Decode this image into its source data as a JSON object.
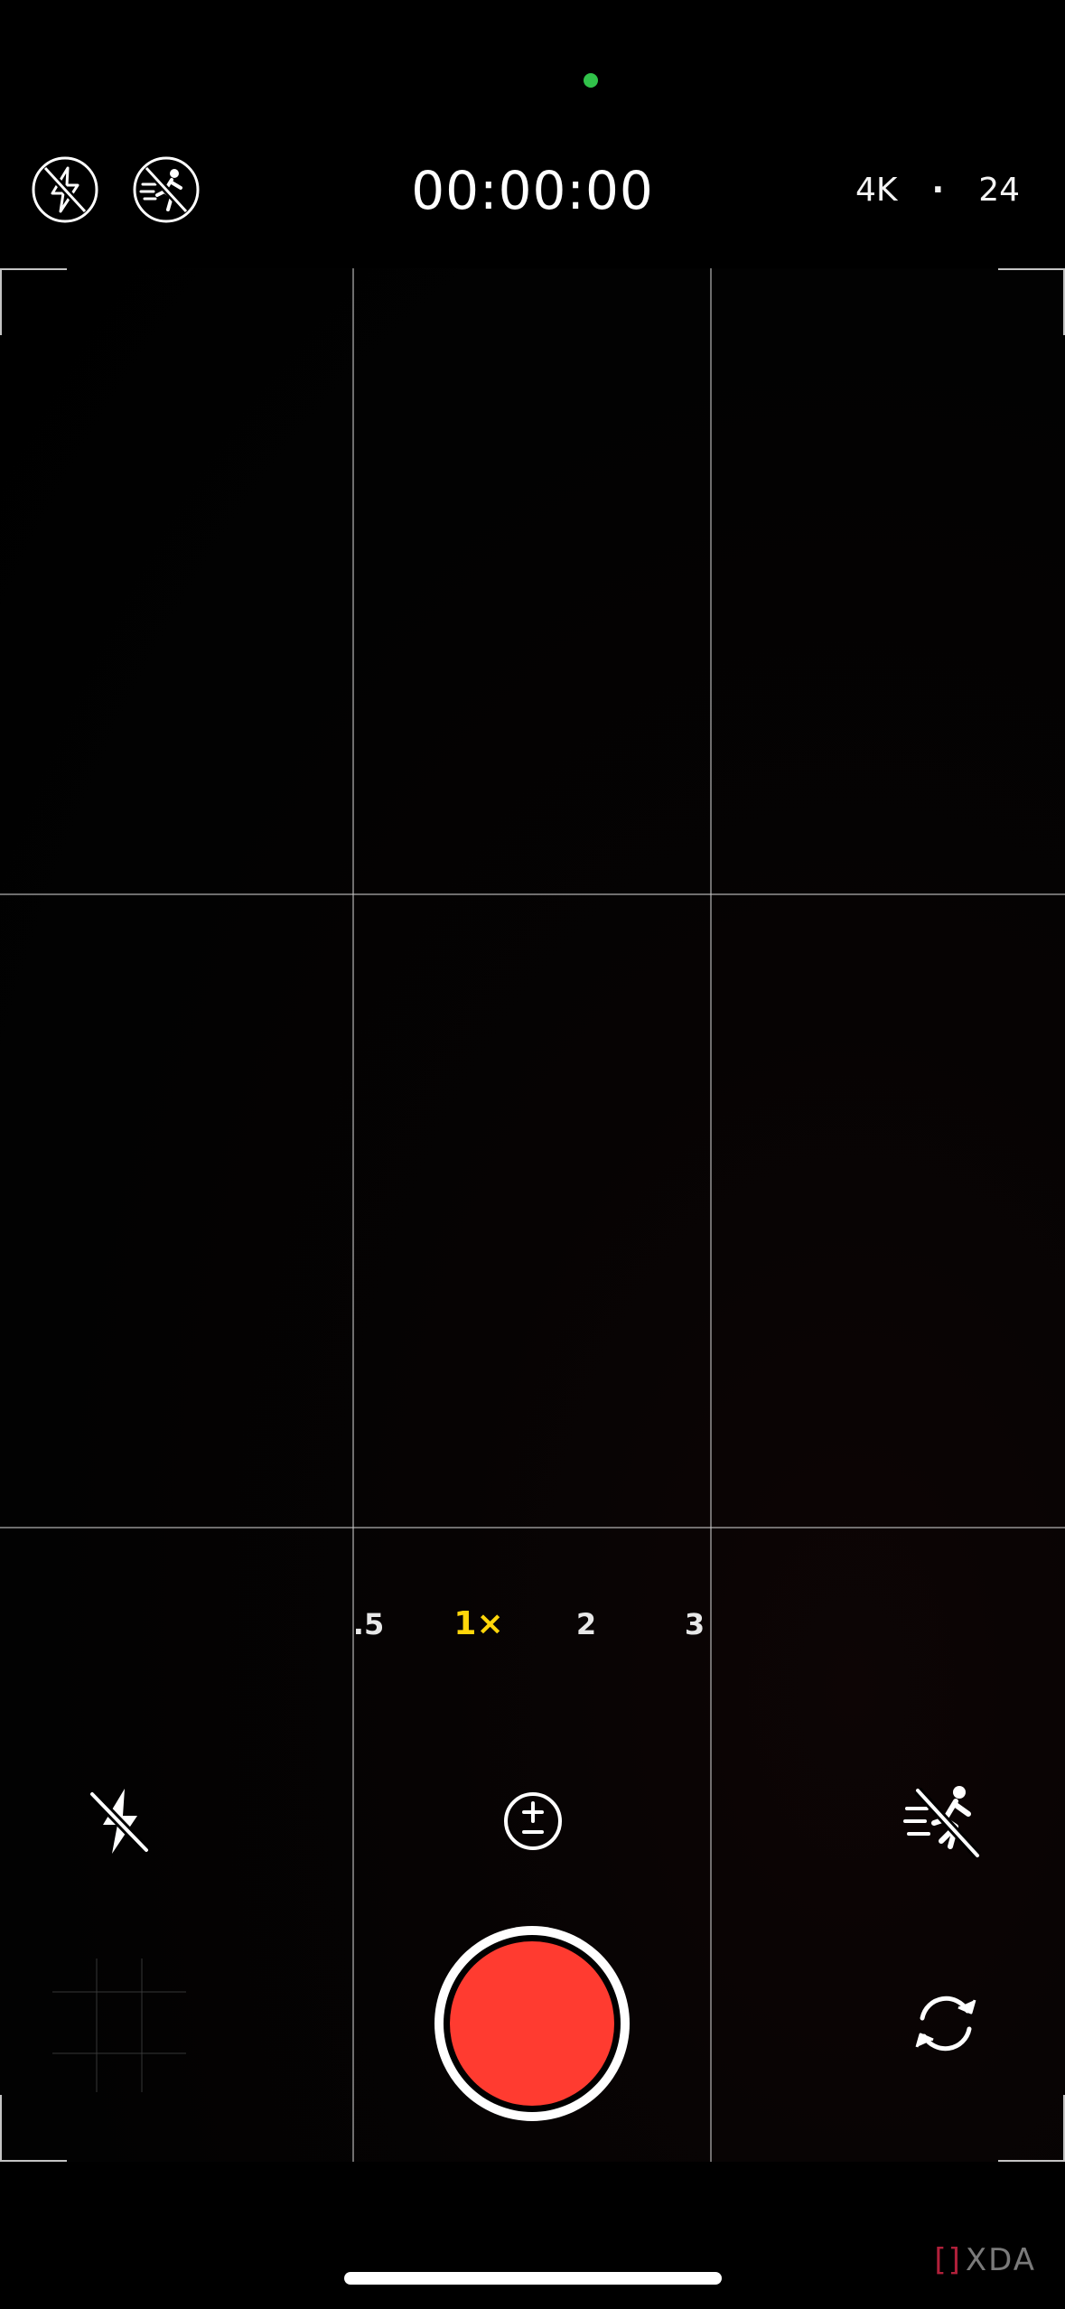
{
  "status": {
    "privacy_indicator_color": "#31c24a"
  },
  "top_bar": {
    "flash_off_icon": "flash-off-icon",
    "action_mode_off_icon": "action-mode-off-icon",
    "timer": "00:00:00",
    "resolution": "4K",
    "separator": "·",
    "frame_rate": "24"
  },
  "zoom": {
    "options": [
      ".5",
      "1×",
      "2",
      "3"
    ],
    "selected": "1×",
    "active_color": "#ffd60a"
  },
  "controls": {
    "flash_icon": "flash-off-icon",
    "exposure_icon": "exposure-plus-minus-icon",
    "action_mode_icon": "action-mode-off-icon",
    "flip_icon": "camera-flip-icon",
    "record_color": "#ff3b30"
  },
  "watermark": {
    "mark": "[]",
    "text": "XDA"
  }
}
